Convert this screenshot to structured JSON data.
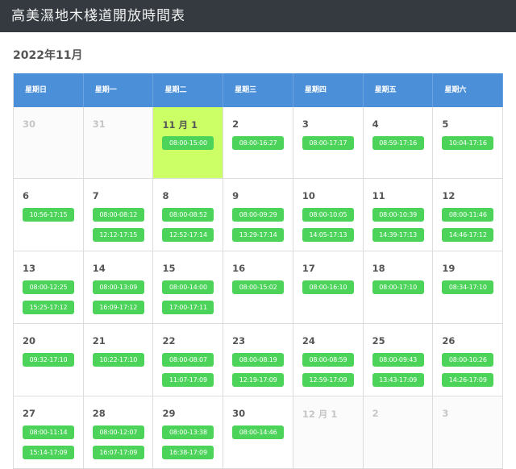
{
  "header": {
    "title": "高美濕地木棧道開放時間表"
  },
  "calendar": {
    "month_title": "2022年11月",
    "weekdays": [
      "星期日",
      "星期一",
      "星期二",
      "星期三",
      "星期四",
      "星期五",
      "星期六"
    ],
    "weeks": [
      [
        {
          "day": "30",
          "other": true,
          "events": []
        },
        {
          "day": "31",
          "other": true,
          "events": []
        },
        {
          "day": "11 月 1",
          "today": true,
          "events": [
            "08:00-15:00"
          ]
        },
        {
          "day": "2",
          "events": [
            "08:00-16:27"
          ]
        },
        {
          "day": "3",
          "events": [
            "08:00-17:17"
          ]
        },
        {
          "day": "4",
          "events": [
            "08:59-17:16"
          ]
        },
        {
          "day": "5",
          "events": [
            "10:04-17:16"
          ]
        }
      ],
      [
        {
          "day": "6",
          "events": [
            "10:56-17:15"
          ]
        },
        {
          "day": "7",
          "events": [
            "08:00-08:12",
            "12:12-17:15"
          ]
        },
        {
          "day": "8",
          "events": [
            "08:00-08:52",
            "12:52-17:14"
          ]
        },
        {
          "day": "9",
          "events": [
            "08:00-09:29",
            "13:29-17:14"
          ]
        },
        {
          "day": "10",
          "events": [
            "08:00-10:05",
            "14:05-17:13"
          ]
        },
        {
          "day": "11",
          "events": [
            "08:00-10:39",
            "14:39-17:13"
          ]
        },
        {
          "day": "12",
          "events": [
            "08:00-11:46",
            "14:46-17:12"
          ]
        }
      ],
      [
        {
          "day": "13",
          "events": [
            "08:00-12:25",
            "15:25-17:12"
          ]
        },
        {
          "day": "14",
          "events": [
            "08:00-13:09",
            "16:09-17:12"
          ]
        },
        {
          "day": "15",
          "events": [
            "08:00-14:00",
            "17:00-17:11"
          ]
        },
        {
          "day": "16",
          "events": [
            "08:00-15:02"
          ]
        },
        {
          "day": "17",
          "events": [
            "08:00-16:10"
          ]
        },
        {
          "day": "18",
          "events": [
            "08:00-17:10"
          ]
        },
        {
          "day": "19",
          "events": [
            "08:34-17:10"
          ]
        }
      ],
      [
        {
          "day": "20",
          "events": [
            "09:32-17:10"
          ]
        },
        {
          "day": "21",
          "events": [
            "10:22-17:10"
          ]
        },
        {
          "day": "22",
          "events": [
            "08:00-08:07",
            "11:07-17:09"
          ]
        },
        {
          "day": "23",
          "events": [
            "08:00-08:19",
            "12:19-17:09"
          ]
        },
        {
          "day": "24",
          "events": [
            "08:00-08:59",
            "12:59-17:09"
          ]
        },
        {
          "day": "25",
          "events": [
            "08:00-09:43",
            "13:43-17:09"
          ]
        },
        {
          "day": "26",
          "events": [
            "08:00-10:26",
            "14:26-17:09"
          ]
        }
      ],
      [
        {
          "day": "27",
          "events": [
            "08:00-11:14",
            "15:14-17:09"
          ]
        },
        {
          "day": "28",
          "events": [
            "08:00-12:07",
            "16:07-17:09"
          ]
        },
        {
          "day": "29",
          "events": [
            "08:00-13:38",
            "16:38-17:09"
          ]
        },
        {
          "day": "30",
          "events": [
            "08:00-14:46"
          ]
        },
        {
          "day": "12 月 1",
          "other": true,
          "events": []
        },
        {
          "day": "2",
          "other": true,
          "events": []
        },
        {
          "day": "3",
          "other": true,
          "events": []
        }
      ]
    ]
  },
  "colors": {
    "header_bg": "#343a40",
    "weekday_bar": "#4a8fd8",
    "today_bg": "#ccff66",
    "event_bg": "#4cd35a"
  }
}
